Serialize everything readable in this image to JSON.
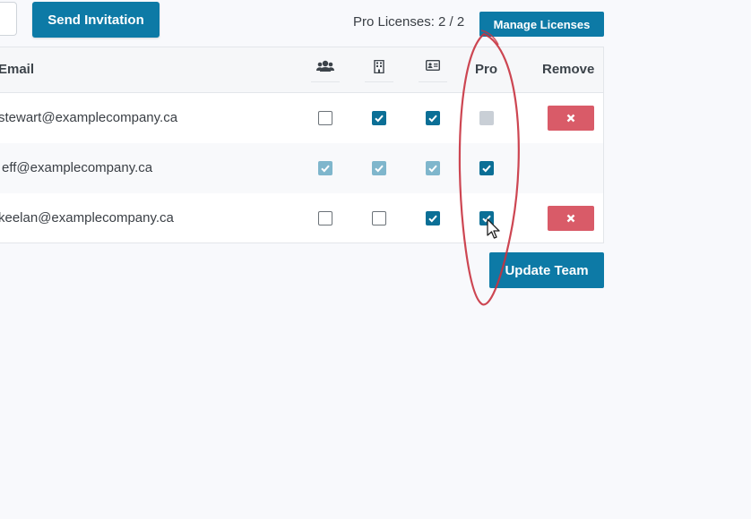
{
  "toolbar": {
    "send_invitation_label": "Send Invitation",
    "licenses_text": "Pro Licenses: 2 / 2",
    "manage_licenses_label": "Manage Licenses"
  },
  "table": {
    "headers": {
      "email": "Email",
      "team_icon": "users-icon",
      "org_icon": "building-icon",
      "card_icon": "id-card-icon",
      "pro": "Pro",
      "remove": "Remove"
    },
    "rows": [
      {
        "email": "stewart@examplecompany.ca",
        "team": "unchecked",
        "org": "checked",
        "card": "checked",
        "pro": "unavailable",
        "removable": true
      },
      {
        "email": "eff@examplecompany.ca",
        "team": "checked-disabled",
        "org": "checked-disabled",
        "card": "checked-disabled",
        "pro": "checked",
        "removable": false
      },
      {
        "email": "keelan@examplecompany.ca",
        "team": "unchecked",
        "org": "unchecked",
        "card": "checked",
        "pro": "checked",
        "removable": true
      }
    ]
  },
  "footer": {
    "update_team_label": "Update Team"
  },
  "colors": {
    "primary": "#0d7aa6",
    "checkbox_checked": "#0b6f96",
    "checkbox_disabled": "#7fb6cc",
    "danger": "#d95b68",
    "annotation": "#c8323f"
  }
}
